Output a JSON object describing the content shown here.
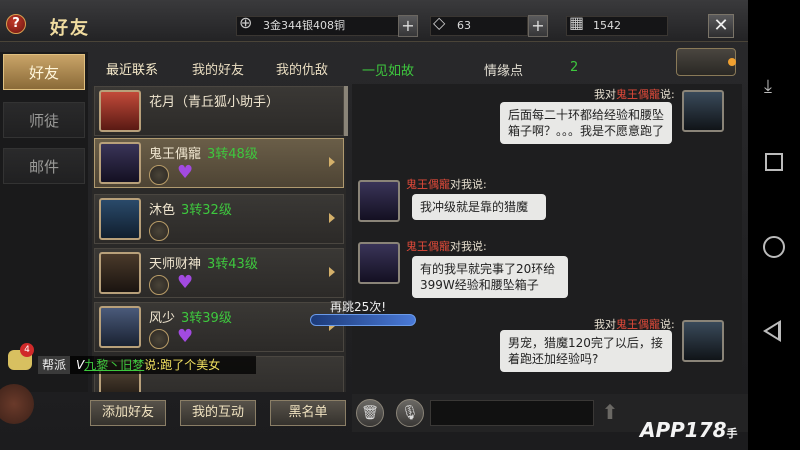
{
  "header": {
    "help_glyph": "?",
    "title": "好友",
    "currency": "3金344银408铜",
    "diamonds": "63",
    "coupons": "1542",
    "plus": "+",
    "close": "✕"
  },
  "side_tabs": [
    {
      "label": "好友",
      "active": true
    },
    {
      "label": "师徒",
      "active": false
    },
    {
      "label": "邮件",
      "active": false
    }
  ],
  "friend_tabs": [
    {
      "label": "最近联系",
      "active": true
    },
    {
      "label": "我的好友",
      "active": false
    },
    {
      "label": "我的仇敌",
      "active": false
    }
  ],
  "friends": [
    {
      "name": "花月（青丘狐小助手）",
      "level": ""
    },
    {
      "name": "鬼王偶寵",
      "level": "3转48级"
    },
    {
      "name": "沐色",
      "level": "3转32级"
    },
    {
      "name": "天师财神",
      "level": "3转43级"
    },
    {
      "name": "风少",
      "level": "3转39级"
    }
  ],
  "bottom_buttons": {
    "add_friend": "添加好友",
    "my_interaction": "我的互动",
    "blacklist": "黑名单"
  },
  "chat": {
    "target_name": "一见如故",
    "intimacy_label": "情缘点",
    "intimacy_value": "2",
    "messages": [
      {
        "side": "right",
        "prefix": "我对",
        "speaker": "鬼王偶寵",
        "suffix": "说:",
        "text": "后面每二十环都给经验和腰坠箱子啊？。。。我是不愿意跑了"
      },
      {
        "side": "left",
        "prefix": "",
        "speaker": "鬼王偶寵",
        "suffix": "对我说:",
        "text": "我冲级就是靠的猎魔"
      },
      {
        "side": "left",
        "prefix": "",
        "speaker": "鬼王偶寵",
        "suffix": "对我说:",
        "text": "有的我早就完事了20环给399W经验和腰坠箱子"
      },
      {
        "side": "right",
        "prefix": "我对",
        "speaker": "鬼王偶寵",
        "suffix": "说:",
        "text": "男宠，猎魔120完了以后，接着跑还加经验吗?"
      }
    ],
    "send_glyph": "⬆"
  },
  "overlay": {
    "world_tag": "帮派",
    "world_prefix": "V",
    "world_name": "九黎丶旧梦",
    "world_text": "说:跑了个美女",
    "unread_count": "4",
    "rejump_text": "再跳25次!"
  },
  "watermark": {
    "main": "APP178",
    "sub": "手游网"
  },
  "colors": {
    "accent": "#c9a468",
    "level_green": "#3ec83e",
    "speaker_red": "#e04a3a"
  }
}
